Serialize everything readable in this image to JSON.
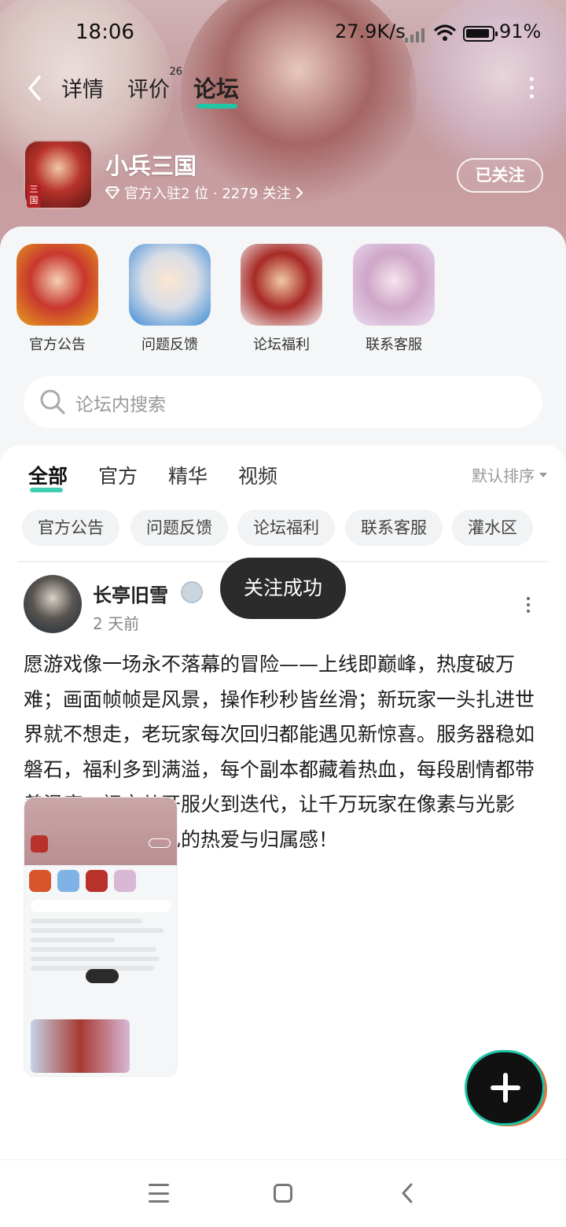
{
  "status_bar": {
    "time": "18:06",
    "net_speed": "27.9K/s",
    "battery": "91%"
  },
  "nav": {
    "tabs": [
      {
        "label": "详情"
      },
      {
        "label": "评价",
        "badge": "26"
      },
      {
        "label": "论坛"
      }
    ],
    "active_tab": "论坛"
  },
  "game": {
    "name": "小兵三国",
    "icon_badge": "三国",
    "meta": "官方入驻2 位 · 2279 关注",
    "follow_label": "已关注"
  },
  "shortcuts": [
    {
      "label": "官方公告"
    },
    {
      "label": "问题反馈"
    },
    {
      "label": "论坛福利"
    },
    {
      "label": "联系客服"
    }
  ],
  "search": {
    "placeholder": "论坛内搜索"
  },
  "feed": {
    "tabs": [
      "全部",
      "官方",
      "精华",
      "视频"
    ],
    "active_tab": "全部",
    "sort_label": "默认排序",
    "chips": [
      "官方公告",
      "问题反馈",
      "论坛福利",
      "联系客服",
      "灌水区"
    ]
  },
  "post": {
    "author": "长亭旧雪",
    "time_ago": "2 天前",
    "text": "愿游戏像一场永不落幕的冒险——上线即巅峰，热度破万难；画面帧帧是风景，操作秒秒皆丝滑；新玩家一头扎进世界就不想走，老玩家每次回归都能遇见新惊喜。服务器稳如磐石，福利多到满溢，每个副本都藏着热血，每段剧情都带着温度。祝它从开服火到迭代，让千万玩家在像素与光影里，找到属于自己的热爱与归属感！"
  },
  "toast": {
    "text": "关注成功"
  },
  "colors": {
    "accent": "#21c6a6",
    "hero": "#c9a6a8",
    "toast_bg": "#2b2b2b"
  }
}
